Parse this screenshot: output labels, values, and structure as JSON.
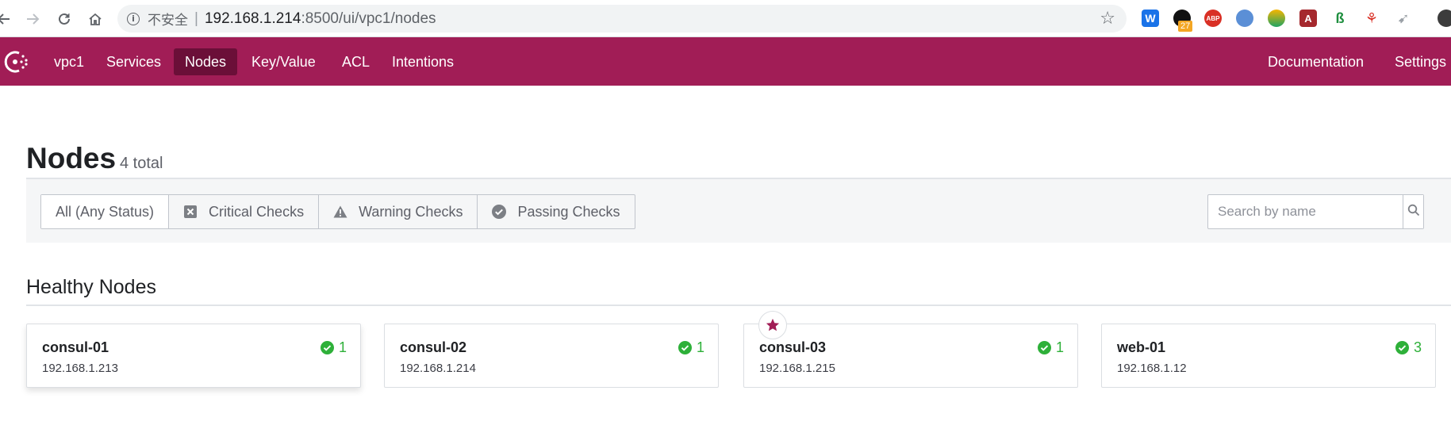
{
  "browser": {
    "insecure_label": "不安全",
    "separator": "|",
    "url_host": "192.168.1.214",
    "url_rest": ":8500/ui/vpc1/nodes",
    "extension_badge": "27",
    "ext_w_label": "W",
    "ext_abp_label": "ABP",
    "ext_a_label": "A"
  },
  "header": {
    "datacenter": "vpc1",
    "nav": [
      {
        "label": "Services"
      },
      {
        "label": "Nodes",
        "active": true
      },
      {
        "label": "Key/Value"
      },
      {
        "label": "ACL"
      },
      {
        "label": "Intentions"
      }
    ],
    "right_nav": [
      {
        "label": "Documentation"
      },
      {
        "label": "Settings"
      }
    ],
    "brand_color": "#a11d56",
    "active_color": "#6b0f38"
  },
  "page": {
    "title": "Nodes",
    "count": "4 total"
  },
  "filters": {
    "items": [
      {
        "label": "All (Any Status)",
        "icon": "none",
        "selected": true
      },
      {
        "label": "Critical Checks",
        "icon": "critical-x-icon"
      },
      {
        "label": "Warning Checks",
        "icon": "warning-triangle-icon"
      },
      {
        "label": "Passing Checks",
        "icon": "passing-check-icon"
      }
    ],
    "search_placeholder": "Search by name"
  },
  "section": {
    "title": "Healthy Nodes"
  },
  "nodes": [
    {
      "name": "consul-01",
      "address": "192.168.1.213",
      "passing": "1",
      "leader": false
    },
    {
      "name": "consul-02",
      "address": "192.168.1.214",
      "passing": "1",
      "leader": false
    },
    {
      "name": "consul-03",
      "address": "192.168.1.215",
      "passing": "1",
      "leader": true
    },
    {
      "name": "web-01",
      "address": "192.168.1.12",
      "passing": "3",
      "leader": false
    }
  ],
  "colors": {
    "passing": "#2eb039",
    "leader_star": "#a11d56"
  }
}
